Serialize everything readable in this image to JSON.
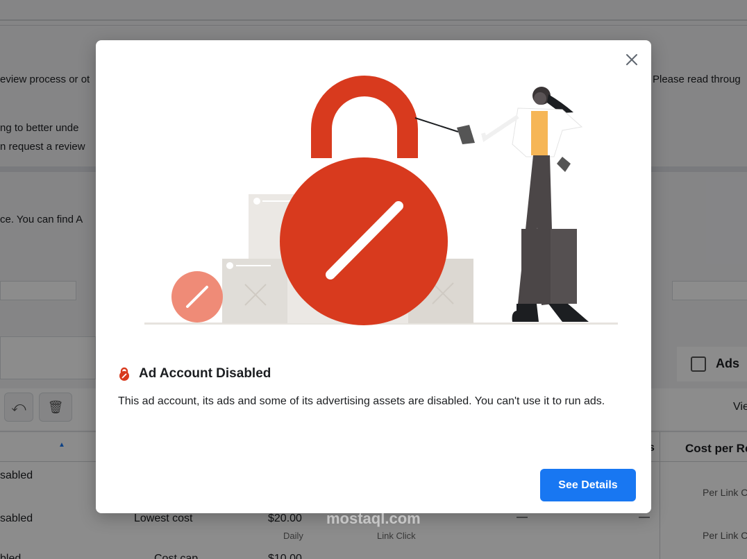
{
  "background": {
    "lines": [
      {
        "text": "eview process or ot",
        "part": "left"
      },
      {
        "text": "ng to better unde",
        "part": "left"
      },
      {
        "text": "n request a review",
        "part": "left"
      },
      {
        "text": "ce. You can find A",
        "part": "left"
      },
      {
        "text": "Please read throug",
        "part": "right"
      }
    ],
    "toolbar": {
      "ads_label": "Ads",
      "view_label": "Vie"
    },
    "table": {
      "header_right": "Cost per Re",
      "header_s": "s",
      "rows": [
        {
          "status": "sabled",
          "bid": "",
          "budget": "",
          "budget_sub": "",
          "result_type": "",
          "cost": "Per Link C"
        },
        {
          "status": "sabled",
          "bid": "Lowest cost",
          "budget": "$20.00",
          "budget_sub": "Daily",
          "result_type": "Link Click",
          "cost": "Per Link C"
        },
        {
          "status": "bled",
          "bid": "Cost cap",
          "budget": "$10.00",
          "budget_sub": "",
          "result_type": "",
          "cost": ""
        }
      ],
      "dash": "—"
    }
  },
  "modal": {
    "title": "Ad Account Disabled",
    "body": "This ad account, its ads and some of its advertising assets are disabled. You can't use it to run ads.",
    "button_label": "See Details"
  },
  "watermark": "mostaql.com",
  "colors": {
    "accent": "#1877f2",
    "lock_red": "#d83a1e",
    "overlay": "rgba(0,0,0,0.45)"
  },
  "icons": [
    "close-icon",
    "lock-alert-icon",
    "undo-icon",
    "trash-icon",
    "panel-icon"
  ]
}
